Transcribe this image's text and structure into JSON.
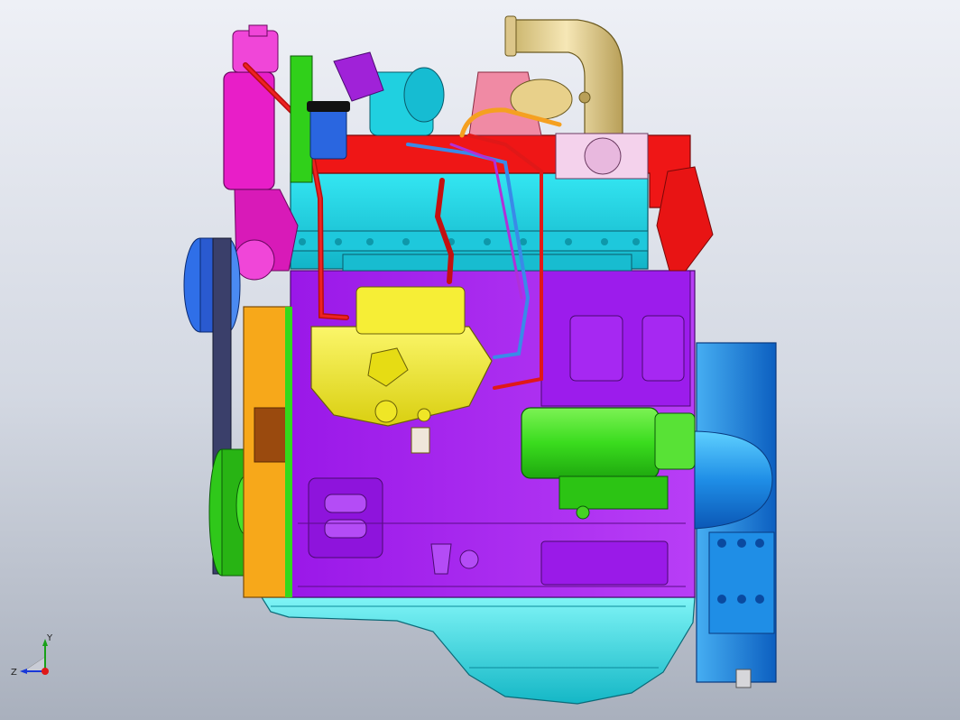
{
  "triad": {
    "y_label": "Y",
    "z_label": "Z"
  },
  "colors": {
    "background_top": "#eef0f6",
    "background_bottom": "#a9b0bd",
    "cylinder_head": "#20d8e8",
    "engine_block": "#a020f0",
    "injection_pump": "#f2ec1a",
    "starter_motor": "#36e81c",
    "flywheel_housing": "#1e8fe6",
    "oil_pan": "#24e8ec",
    "timing_cover": "#f7a81a",
    "oil_filter": "#e81ec8",
    "exhaust_pipe": "#e8cf8a",
    "valve_cover": "#f01616",
    "fuel_lines": "#e81818",
    "crank_pulley": "#2f6fe8"
  },
  "parts": [
    "cylinder-head",
    "engine-block",
    "fuel-injection-pump",
    "starter-motor",
    "flywheel-housing",
    "oil-pan",
    "timing-cover",
    "oil-filter-housing",
    "exhaust-elbow",
    "turbocharger",
    "fan-pulley",
    "crankshaft-pulley"
  ]
}
